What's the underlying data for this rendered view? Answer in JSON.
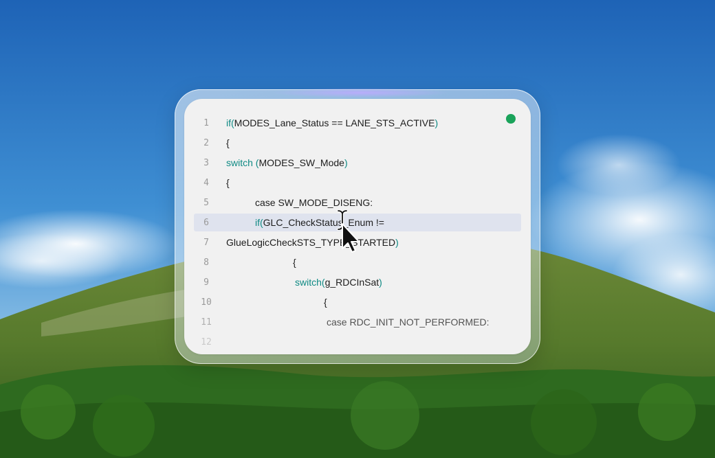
{
  "editor": {
    "status_color": "#1aa35a",
    "lines": [
      {
        "num": "1",
        "parts": [
          {
            "t": "if",
            "kw": true
          },
          {
            "t": "(",
            "kw": true
          },
          {
            "t": "MODES_Lane_Status == LANE_STS_ACTIVE"
          },
          {
            "t": ")",
            "kw": true
          }
        ]
      },
      {
        "num": "2",
        "parts": [
          {
            "t": " {"
          }
        ]
      },
      {
        "num": "3",
        "parts": [
          {
            "t": " switch (",
            "kw": true
          },
          {
            "t": "MODES_SW_Mode"
          },
          {
            "t": ")",
            "kw": true
          }
        ]
      },
      {
        "num": "4",
        "parts": [
          {
            "t": " {"
          }
        ]
      },
      {
        "num": "5",
        "parts": [
          {
            "t": "case SW_MODE_DISENG:"
          }
        ]
      },
      {
        "num": "6",
        "parts": [
          {
            "t": "if",
            "kw": true
          },
          {
            "t": "(",
            "kw": true
          },
          {
            "t": "GLC_CheckStatus_Enum !="
          }
        ]
      },
      {
        "num": "7",
        "parts": [
          {
            "t": "GlueLogicCheckSTS_TYPE_STARTED"
          },
          {
            "t": ")",
            "kw": true
          }
        ]
      },
      {
        "num": "8",
        "parts": [
          {
            "t": "{"
          }
        ]
      },
      {
        "num": "9",
        "parts": [
          {
            "t": "switch",
            "kw": true
          },
          {
            "t": "(",
            "kw": true
          },
          {
            "t": "g_RDCInSat"
          },
          {
            "t": ")",
            "kw": true
          }
        ]
      },
      {
        "num": "10",
        "parts": [
          {
            "t": "{"
          }
        ]
      },
      {
        "num": "11",
        "parts": [
          {
            "t": "case RDC_INIT_NOT_PERFORMED:"
          }
        ]
      },
      {
        "num": "12",
        "parts": []
      }
    ],
    "highlighted_line": "6"
  }
}
